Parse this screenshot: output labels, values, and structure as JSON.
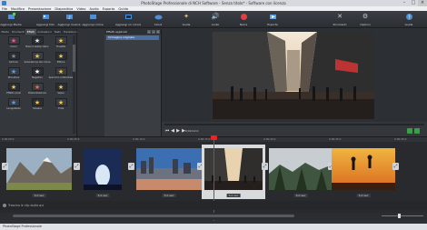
{
  "window": {
    "title": "PhotoStage Professionale di NCH Software - Senza titolo* - Software con licenza",
    "center_title": "PhotoStage Professionale di NCH Software - Senza titolo* - Software con licenza"
  },
  "menubar": {
    "items": [
      "File",
      "Modifica",
      "Presentazione",
      "Diapositiva",
      "Video",
      "Audio",
      "Esporta",
      "Guida"
    ]
  },
  "toolbar": {
    "items": [
      {
        "label": "Aggiungi Media",
        "icon": "add-media-icon",
        "color": "#4b8fd8"
      },
      {
        "label": "Aggiungi foto",
        "icon": "add-photo-icon",
        "color": "#4b8fd8"
      },
      {
        "label": "Aggiungi musica",
        "icon": "add-music-icon",
        "color": "#4b8fd8"
      },
      {
        "label": "Aggiungi colore",
        "icon": "add-color-icon",
        "color": "#4b8fd8"
      },
      {
        "label": "Aggiungi un colore",
        "icon": "add-blank-icon",
        "color": "#4b8fd8"
      },
      {
        "label": "Cloud",
        "icon": "cloud-icon",
        "color": "#4b8fd8"
      },
      {
        "label": "Guida",
        "icon": "guide-icon",
        "color": "#f2c94c"
      },
      {
        "label": "Audio",
        "icon": "audio-icon",
        "color": "#b9bdc3"
      },
      {
        "label": "Narra",
        "icon": "record-icon",
        "color": "#e04040"
      },
      {
        "label": "Esporta",
        "icon": "export-icon",
        "color": "#5aa0e8"
      },
      {
        "label": "Strumenti",
        "icon": "tools-icon",
        "color": "#c9cdd2"
      },
      {
        "label": "Opzioni",
        "icon": "options-icon",
        "color": "#c9cdd2"
      },
      {
        "label": "Guida",
        "icon": "help-icon",
        "color": "#4b8fd8"
      }
    ]
  },
  "left_panel": {
    "tabs": [
      "Media",
      "Strumenti",
      "Effetti",
      "Animazioni",
      "Testo",
      "Transizioni"
    ],
    "active_tab": "Effetti",
    "effects": [
      {
        "label": "Colori",
        "glyph": "★",
        "color": "#ff4f9a"
      },
      {
        "label": "Bianco &amp; Nero",
        "glyph": "★",
        "color": "#e6e6e6"
      },
      {
        "label": "Tonalità",
        "glyph": "★",
        "color": "#f2c94c"
      },
      {
        "label": "Cartoon",
        "glyph": "★",
        "color": "#8a8a8a"
      },
      {
        "label": "Saturazione del colore",
        "glyph": "★",
        "color": "#f2c94c"
      },
      {
        "label": "Pittura",
        "glyph": "★",
        "color": "#f2c94c"
      },
      {
        "label": "Sfocatura",
        "glyph": "★",
        "color": "#5aa0e8"
      },
      {
        "label": "Negativo",
        "glyph": "★",
        "color": "#ffffff"
      },
      {
        "label": "Specchio orizzontale",
        "glyph": "★",
        "color": "#f2c94c"
      },
      {
        "label": "Effetto pixel",
        "glyph": "★",
        "color": "#f2c94c"
      },
      {
        "label": "Posterizzazione",
        "glyph": "★",
        "color": "#ff6a3d"
      },
      {
        "label": "Sepia",
        "glyph": "★",
        "color": "#f2c94c"
      },
      {
        "label": "Levigatezza",
        "glyph": "★",
        "color": "#5aa0e8"
      },
      {
        "label": "Soleare",
        "glyph": "★",
        "color": "#f2c94c"
      },
      {
        "label": "Tinta",
        "glyph": "★",
        "color": "#f2c94c"
      }
    ]
  },
  "mid_panel": {
    "title": "Effetti applicati",
    "rows": [
      "Immagine originale"
    ],
    "buttons": [
      "+",
      "−",
      "×"
    ]
  },
  "preview": {
    "timecode": "0:00:12.0"
  },
  "timeline": {
    "ruler_marks": [
      "0:00:00.0",
      "0:00:05.0",
      "0:00:10.0",
      "0:00:15.0",
      "0:00:20.0",
      "0:00:25.0",
      "0:00:30.0"
    ],
    "clips": [
      {
        "duration": "5,0 sec"
      },
      {
        "duration": "5,0 sec"
      },
      {
        "duration": "5,0 sec"
      },
      {
        "duration": "5,0 sec"
      },
      {
        "duration": "5,0 sec"
      },
      {
        "duration": "5,0 sec"
      }
    ],
    "audio_hint": "Trascina le clip audio qui"
  },
  "status": {
    "text": "PhotoStage Professionale"
  }
}
